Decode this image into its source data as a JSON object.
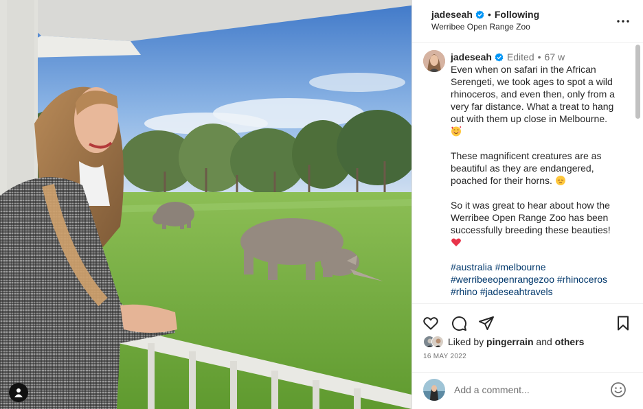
{
  "header": {
    "username": "jadeseah",
    "separator": "•",
    "follow_status": "Following",
    "location": "Werribee Open Range Zoo"
  },
  "caption": {
    "username": "jadeseah",
    "edited": "Edited",
    "separator": "•",
    "age": "67 w",
    "paragraph_1": "Even when on safari in the African Serengeti, we took ages to spot a wild rhinoceros, and even then, only from a very far distance. What a treat to hang out with them up close in Melbourne.",
    "paragraph_2": "These magnificent creatures are as beautiful as they are endangered, poached for their horns.",
    "paragraph_3": "So it was great to hear about how the Werribee Open Range Zoo has been successfully breeding these beauties!",
    "hashtags": [
      "#australia",
      "#melbourne",
      "#werribeeopenrangezoo",
      "#rhinoceros",
      "#rhino",
      "#jadeseahtravels"
    ]
  },
  "likes": {
    "prefix": "Liked by",
    "user": "pingerrain",
    "conjunction": "and",
    "others": "others"
  },
  "date": "16 MAY 2022",
  "comment_box": {
    "placeholder": "Add a comment..."
  },
  "icons": {
    "verified": "verified-badge-icon",
    "more": "more-options-icon",
    "like": "heart-icon",
    "comment": "comment-bubble-icon",
    "share": "paper-plane-icon",
    "save": "bookmark-icon",
    "emoji_picker": "smiley-icon",
    "tagged_users": "user-tag-icon"
  },
  "colors": {
    "link": "#00376b",
    "verified": "#0095f6",
    "muted": "#737373"
  }
}
